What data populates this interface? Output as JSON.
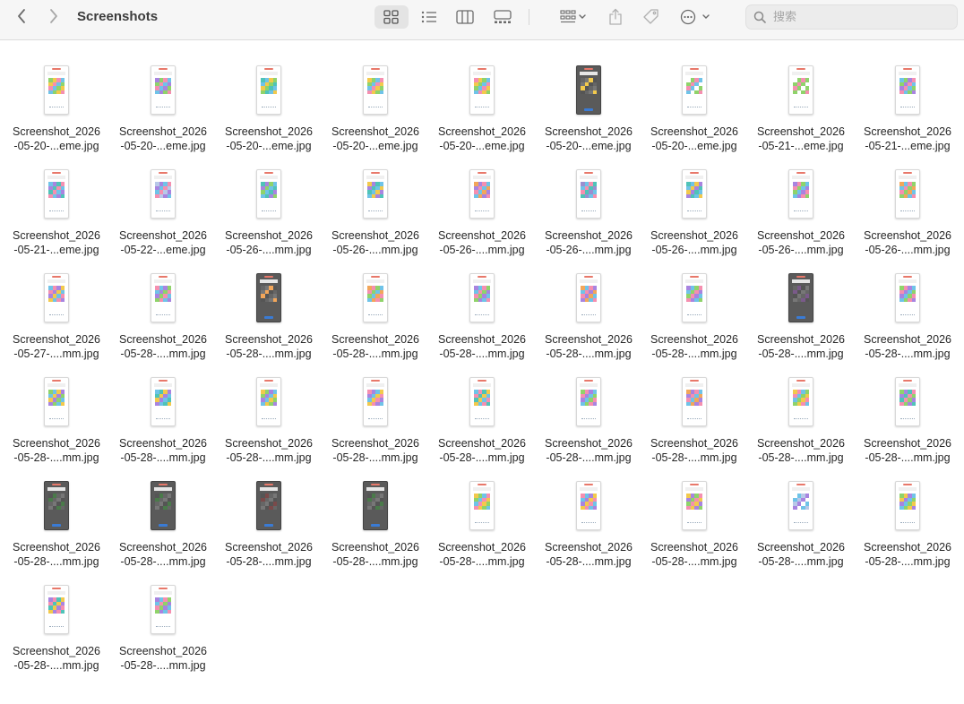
{
  "window": {
    "title": "Screenshots"
  },
  "toolbar": {
    "back_icon": "chevron-left-icon",
    "forward_icon": "chevron-right-icon",
    "views": [
      "icon-view",
      "list-view",
      "column-view",
      "gallery-view"
    ],
    "active_view": "icon-view",
    "group_icon": "group-icon",
    "share_icon": "share-icon",
    "tag_icon": "tag-icon",
    "more_icon": "ellipsis-icon"
  },
  "search": {
    "placeholder": "搜索",
    "value": ""
  },
  "files": [
    {
      "line1": "Screenshot_2026",
      "line2": "-05-20-...eme.jpg",
      "style": "light",
      "colors": [
        "#8fd36a",
        "#f2c94c",
        "#f58fb0",
        "#6fc3e8"
      ]
    },
    {
      "line1": "Screenshot_2026",
      "line2": "-05-20-...eme.jpg",
      "style": "light",
      "colors": [
        "#a884e0",
        "#8fd36a",
        "#f58fb0",
        "#6fc3e8"
      ]
    },
    {
      "line1": "Screenshot_2026",
      "line2": "-05-20-...eme.jpg",
      "style": "light",
      "colors": [
        "#4fc3b8",
        "#6fc3e8",
        "#f2c94c",
        "#8fd36a"
      ]
    },
    {
      "line1": "Screenshot_2026",
      "line2": "-05-20-...eme.jpg",
      "style": "light",
      "colors": [
        "#f2c94c",
        "#8fd36a",
        "#6fc3e8",
        "#f58fb0"
      ]
    },
    {
      "line1": "Screenshot_2026",
      "line2": "-05-20-...eme.jpg",
      "style": "light",
      "colors": [
        "#f58fb0",
        "#f2c94c",
        "#8fd36a",
        "#6fc3e8"
      ]
    },
    {
      "line1": "Screenshot_2026",
      "line2": "-05-20-...eme.jpg",
      "style": "dark",
      "colors": [
        "#666",
        "#777",
        "#f2c94c",
        "#555"
      ]
    },
    {
      "line1": "Screenshot_2026",
      "line2": "-05-20-...eme.jpg",
      "style": "light",
      "colors": [
        "#ffffff",
        "#8fd36a",
        "#f58fb0",
        "#6fc3e8"
      ]
    },
    {
      "line1": "Screenshot_2026",
      "line2": "-05-21-...eme.jpg",
      "style": "light",
      "colors": [
        "#ffffff",
        "#8fd36a",
        "#f58fb0",
        "#8fd36a"
      ]
    },
    {
      "line1": "Screenshot_2026",
      "line2": "-05-21-...eme.jpg",
      "style": "light",
      "colors": [
        "#6fc3e8",
        "#8fd36a",
        "#a884e0",
        "#f58fb0"
      ]
    },
    {
      "line1": "Screenshot_2026",
      "line2": "-05-21-...eme.jpg",
      "style": "light",
      "colors": [
        "#6fc3e8",
        "#a884e0",
        "#4fc3b8",
        "#f58fb0"
      ]
    },
    {
      "line1": "Screenshot_2026",
      "line2": "-05-22-...eme.jpg",
      "style": "light",
      "colors": [
        "#b8c8e8",
        "#a884e0",
        "#6fc3e8",
        "#f58fb0"
      ]
    },
    {
      "line1": "Screenshot_2026",
      "line2": "-05-26-....mm.jpg",
      "style": "light",
      "colors": [
        "#4fc3b8",
        "#a884e0",
        "#8fd36a",
        "#6fc3e8"
      ]
    },
    {
      "line1": "Screenshot_2026",
      "line2": "-05-26-....mm.jpg",
      "style": "light",
      "colors": [
        "#f2c94c",
        "#a884e0",
        "#4fc3b8",
        "#6fc3e8"
      ]
    },
    {
      "line1": "Screenshot_2026",
      "line2": "-05-26-....mm.jpg",
      "style": "light",
      "colors": [
        "#f2a65a",
        "#a884e0",
        "#f58fb0",
        "#6fc3e8"
      ]
    },
    {
      "line1": "Screenshot_2026",
      "line2": "-05-26-....mm.jpg",
      "style": "light",
      "colors": [
        "#9a8fd0",
        "#6fc3e8",
        "#f58fb0",
        "#4fc3b8"
      ]
    },
    {
      "line1": "Screenshot_2026",
      "line2": "-05-26-....mm.jpg",
      "style": "light",
      "colors": [
        "#4fc3b8",
        "#6fc3e8",
        "#f2c94c",
        "#a884e0"
      ]
    },
    {
      "line1": "Screenshot_2026",
      "line2": "-05-26-....mm.jpg",
      "style": "light",
      "colors": [
        "#a884e0",
        "#f58fb0",
        "#8fd36a",
        "#6fc3e8"
      ]
    },
    {
      "line1": "Screenshot_2026",
      "line2": "-05-26-....mm.jpg",
      "style": "light",
      "colors": [
        "#f2a65a",
        "#6fc3e8",
        "#f58fb0",
        "#8fd36a"
      ]
    },
    {
      "line1": "Screenshot_2026",
      "line2": "-05-27-....mm.jpg",
      "style": "light",
      "colors": [
        "#6fc3e8",
        "#f58fb0",
        "#a884e0",
        "#f2c94c"
      ]
    },
    {
      "line1": "Screenshot_2026",
      "line2": "-05-28-....mm.jpg",
      "style": "light",
      "colors": [
        "#f58fb0",
        "#6fc3e8",
        "#a884e0",
        "#8fd36a"
      ]
    },
    {
      "line1": "Screenshot_2026",
      "line2": "-05-28-....mm.jpg",
      "style": "dark",
      "colors": [
        "#666",
        "#777",
        "#f2a65a",
        "#555"
      ]
    },
    {
      "line1": "Screenshot_2026",
      "line2": "-05-28-....mm.jpg",
      "style": "light",
      "colors": [
        "#f2a65a",
        "#f58fb0",
        "#8fd36a",
        "#6fc3e8"
      ]
    },
    {
      "line1": "Screenshot_2026",
      "line2": "-05-28-....mm.jpg",
      "style": "light",
      "colors": [
        "#a884e0",
        "#6fc3e8",
        "#f58fb0",
        "#8fd36a"
      ]
    },
    {
      "line1": "Screenshot_2026",
      "line2": "-05-28-....mm.jpg",
      "style": "light",
      "colors": [
        "#f2a65a",
        "#6fc3e8",
        "#f58fb0",
        "#a884e0"
      ]
    },
    {
      "line1": "Screenshot_2026",
      "line2": "-05-28-....mm.jpg",
      "style": "light",
      "colors": [
        "#a884e0",
        "#6fc3e8",
        "#8fd36a",
        "#f58fb0"
      ]
    },
    {
      "line1": "Screenshot_2026",
      "line2": "-05-28-....mm.jpg",
      "style": "dark",
      "colors": [
        "#666",
        "#7a5a8a",
        "#555",
        "#777"
      ]
    },
    {
      "line1": "Screenshot_2026",
      "line2": "-05-28-....mm.jpg",
      "style": "light",
      "colors": [
        "#8fd36a",
        "#f58fb0",
        "#a884e0",
        "#6fc3e8"
      ]
    },
    {
      "line1": "Screenshot_2026",
      "line2": "-05-28-....mm.jpg",
      "style": "light",
      "colors": [
        "#8fd36a",
        "#6fc3e8",
        "#f2c94c",
        "#a884e0"
      ]
    },
    {
      "line1": "Screenshot_2026",
      "line2": "-05-28-....mm.jpg",
      "style": "light",
      "colors": [
        "#6fc3e8",
        "#4fc3b8",
        "#f2c94c",
        "#a884e0"
      ]
    },
    {
      "line1": "Screenshot_2026",
      "line2": "-05-28-....mm.jpg",
      "style": "light",
      "colors": [
        "#f2c94c",
        "#8fd36a",
        "#a884e0",
        "#6fc3e8"
      ]
    },
    {
      "line1": "Screenshot_2026",
      "line2": "-05-28-....mm.jpg",
      "style": "light",
      "colors": [
        "#f58fb0",
        "#a884e0",
        "#6fc3e8",
        "#f2c94c"
      ]
    },
    {
      "line1": "Screenshot_2026",
      "line2": "-05-28-....mm.jpg",
      "style": "light",
      "colors": [
        "#6fc3e8",
        "#f58fb0",
        "#4fc3b8",
        "#f2c94c"
      ]
    },
    {
      "line1": "Screenshot_2026",
      "line2": "-05-28-....mm.jpg",
      "style": "light",
      "colors": [
        "#8fd36a",
        "#f58fb0",
        "#a884e0",
        "#6fc3e8"
      ]
    },
    {
      "line1": "Screenshot_2026",
      "line2": "-05-28-....mm.jpg",
      "style": "light",
      "colors": [
        "#f2a65a",
        "#a884e0",
        "#f58fb0",
        "#6fc3e8"
      ]
    },
    {
      "line1": "Screenshot_2026",
      "line2": "-05-28-....mm.jpg",
      "style": "light",
      "colors": [
        "#f2c94c",
        "#f58fb0",
        "#6fc3e8",
        "#8fd36a"
      ]
    },
    {
      "line1": "Screenshot_2026",
      "line2": "-05-28-....mm.jpg",
      "style": "light",
      "colors": [
        "#8fd36a",
        "#a884e0",
        "#4fc3b8",
        "#f58fb0"
      ]
    },
    {
      "line1": "Screenshot_2026",
      "line2": "-05-28-....mm.jpg",
      "style": "dark",
      "colors": [
        "#555",
        "#4a7a4a",
        "#666",
        "#777"
      ]
    },
    {
      "line1": "Screenshot_2026",
      "line2": "-05-28-....mm.jpg",
      "style": "dark",
      "colors": [
        "#555",
        "#4a7a4a",
        "#666",
        "#777"
      ]
    },
    {
      "line1": "Screenshot_2026",
      "line2": "-05-28-....mm.jpg",
      "style": "dark",
      "colors": [
        "#555",
        "#7a4a4a",
        "#666",
        "#777"
      ]
    },
    {
      "line1": "Screenshot_2026",
      "line2": "-05-28-....mm.jpg",
      "style": "dark",
      "colors": [
        "#555",
        "#4a7a4a",
        "#666",
        "#777"
      ]
    },
    {
      "line1": "Screenshot_2026",
      "line2": "-05-28-....mm.jpg",
      "style": "light",
      "colors": [
        "#f2c94c",
        "#8fd36a",
        "#6fc3e8",
        "#f58fb0"
      ]
    },
    {
      "line1": "Screenshot_2026",
      "line2": "-05-28-....mm.jpg",
      "style": "light",
      "colors": [
        "#f58fb0",
        "#6fc3e8",
        "#a884e0",
        "#f2c94c"
      ]
    },
    {
      "line1": "Screenshot_2026",
      "line2": "-05-28-....mm.jpg",
      "style": "light",
      "colors": [
        "#f2c94c",
        "#a884e0",
        "#8fd36a",
        "#f58fb0"
      ]
    },
    {
      "line1": "Screenshot_2026",
      "line2": "-05-28-....mm.jpg",
      "style": "light",
      "colors": [
        "#ffffff",
        "#6fc3e8",
        "#b8c8e8",
        "#a884e0"
      ]
    },
    {
      "line1": "Screenshot_2026",
      "line2": "-05-28-....mm.jpg",
      "style": "light",
      "colors": [
        "#8fd36a",
        "#f2c94c",
        "#a884e0",
        "#6fc3e8"
      ]
    },
    {
      "line1": "Screenshot_2026",
      "line2": "-05-28-....mm.jpg",
      "style": "light",
      "colors": [
        "#a884e0",
        "#f58fb0",
        "#4fc3b8",
        "#f2c94c"
      ]
    },
    {
      "line1": "Screenshot_2026",
      "line2": "-05-28-....mm.jpg",
      "style": "light",
      "colors": [
        "#a884e0",
        "#6fc3e8",
        "#f58fb0",
        "#8fd36a"
      ]
    }
  ]
}
